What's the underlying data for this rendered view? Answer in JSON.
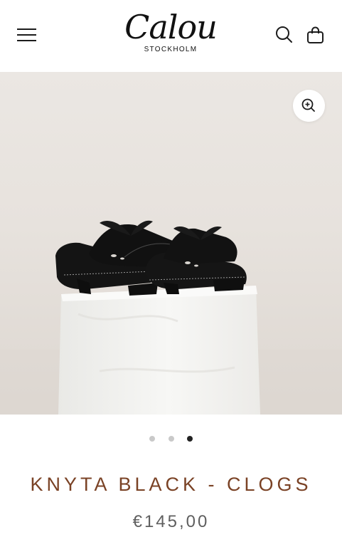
{
  "header": {
    "logo_text": "Calou",
    "logo_subtitle": "STOCKHOLM",
    "icons": {
      "menu": "hamburger-menu-icon",
      "search": "search-icon",
      "cart": "shopping-bag-icon"
    }
  },
  "gallery": {
    "image_subject": "black clogs with ribbon bows on white plinth",
    "zoom_icon": "zoom-in-icon",
    "slides": 3,
    "active_slide": 3
  },
  "product": {
    "title": "KNYTA BLACK - CLOGS",
    "price": "€145,00"
  },
  "colors": {
    "title": "#7a4225",
    "price": "#5f5f5f",
    "dot_active": "#222222",
    "dot_inactive": "#c9c9c9"
  }
}
